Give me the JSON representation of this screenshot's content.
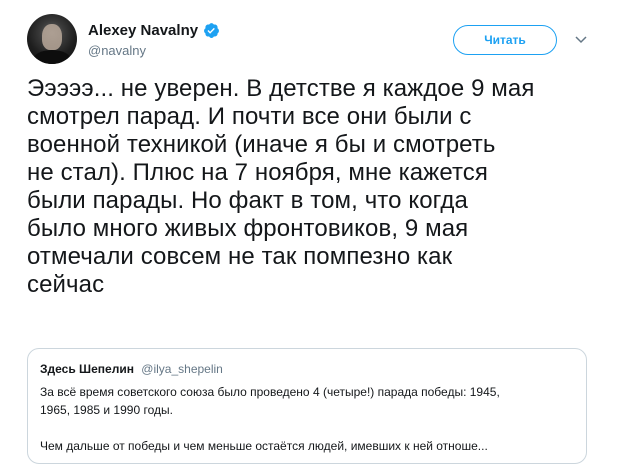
{
  "author": {
    "display_name": "Alexey Navalny",
    "handle": "@navalny",
    "verified": true
  },
  "actions": {
    "follow_label": "Читать"
  },
  "tweet": {
    "text": "Эээээ... не уверен. В детстве я каждое 9 мая\nсмотрел парад. И почти все они были с\nвоенной техникой (иначе я бы и смотреть\nне стал). Плюс на 7 ноября, мне кажется\nбыли парады. Но факт в том, что когда\nбыло много живых фронтовиков, 9 мая\nотмечали совсем не так помпезно как\nсейчас"
  },
  "quoted_tweet": {
    "display_name": "Здесь Шепелин",
    "handle": "@ilya_shepelin",
    "text": "За всё время советского союза было проведено 4 (четыре!) парада победы: 1945,\n1965, 1985 и 1990 годы.\n\nЧем дальше от победы и чем меньше остаётся людей, имевших к ней отноше..."
  },
  "colors": {
    "accent": "#1da1f2",
    "text": "#14171a",
    "secondary_text": "#657786",
    "border": "#ccd6dd"
  },
  "icons": {
    "verified": "verified-badge-icon",
    "caret": "chevron-down-icon"
  }
}
